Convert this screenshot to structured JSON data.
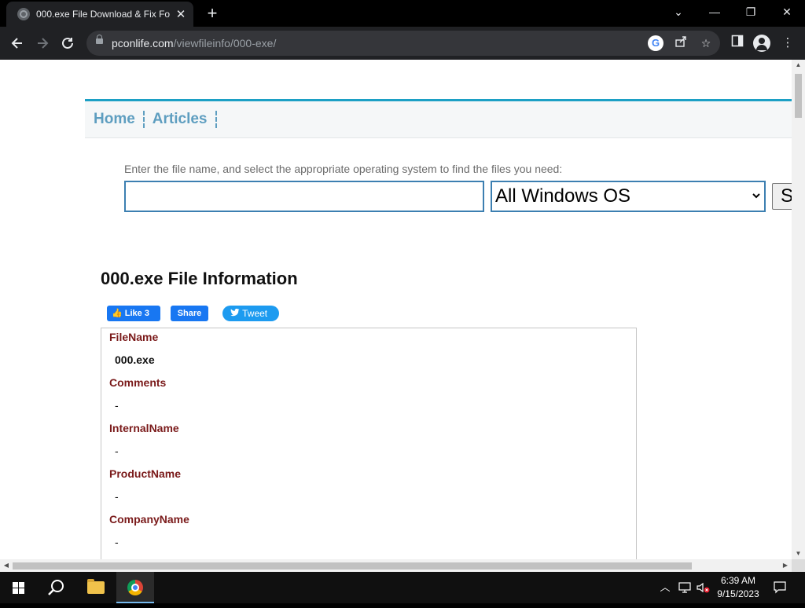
{
  "browser": {
    "tab_title": "000.exe File Download & Fix For",
    "tab_close": "✕",
    "new_tab": "+",
    "url_domain": "pconlife.com",
    "url_path": "/viewfileinfo/000-exe/",
    "window_controls": {
      "minimize": "—",
      "restore": "❐",
      "close": "✕",
      "tab_search": "⌄"
    }
  },
  "site": {
    "nav": [
      "Home",
      "Articles"
    ],
    "search_hint": "Enter the file name, and select the appropriate operating system to find the files you need:",
    "search_value": "",
    "os_select_value": "All Windows OS",
    "search_button_label": "S",
    "page_title": "000.exe File Information",
    "social": {
      "fb_like": "Like 3",
      "fb_share": "Share",
      "tweet": "Tweet"
    },
    "info_fields": [
      {
        "label": "FileName",
        "value": "000.exe"
      },
      {
        "label": "Comments",
        "value": "-"
      },
      {
        "label": "InternalName",
        "value": "-"
      },
      {
        "label": "ProductName",
        "value": "-"
      },
      {
        "label": "CompanyName",
        "value": "-"
      }
    ]
  },
  "taskbar": {
    "time": "6:39 AM",
    "date": "9/15/2023"
  },
  "colors": {
    "nav_accent": "#1ca0c5",
    "nav_link": "#5e9ec0",
    "label_color": "#7a1a1a",
    "input_border": "#3c7fb1"
  }
}
